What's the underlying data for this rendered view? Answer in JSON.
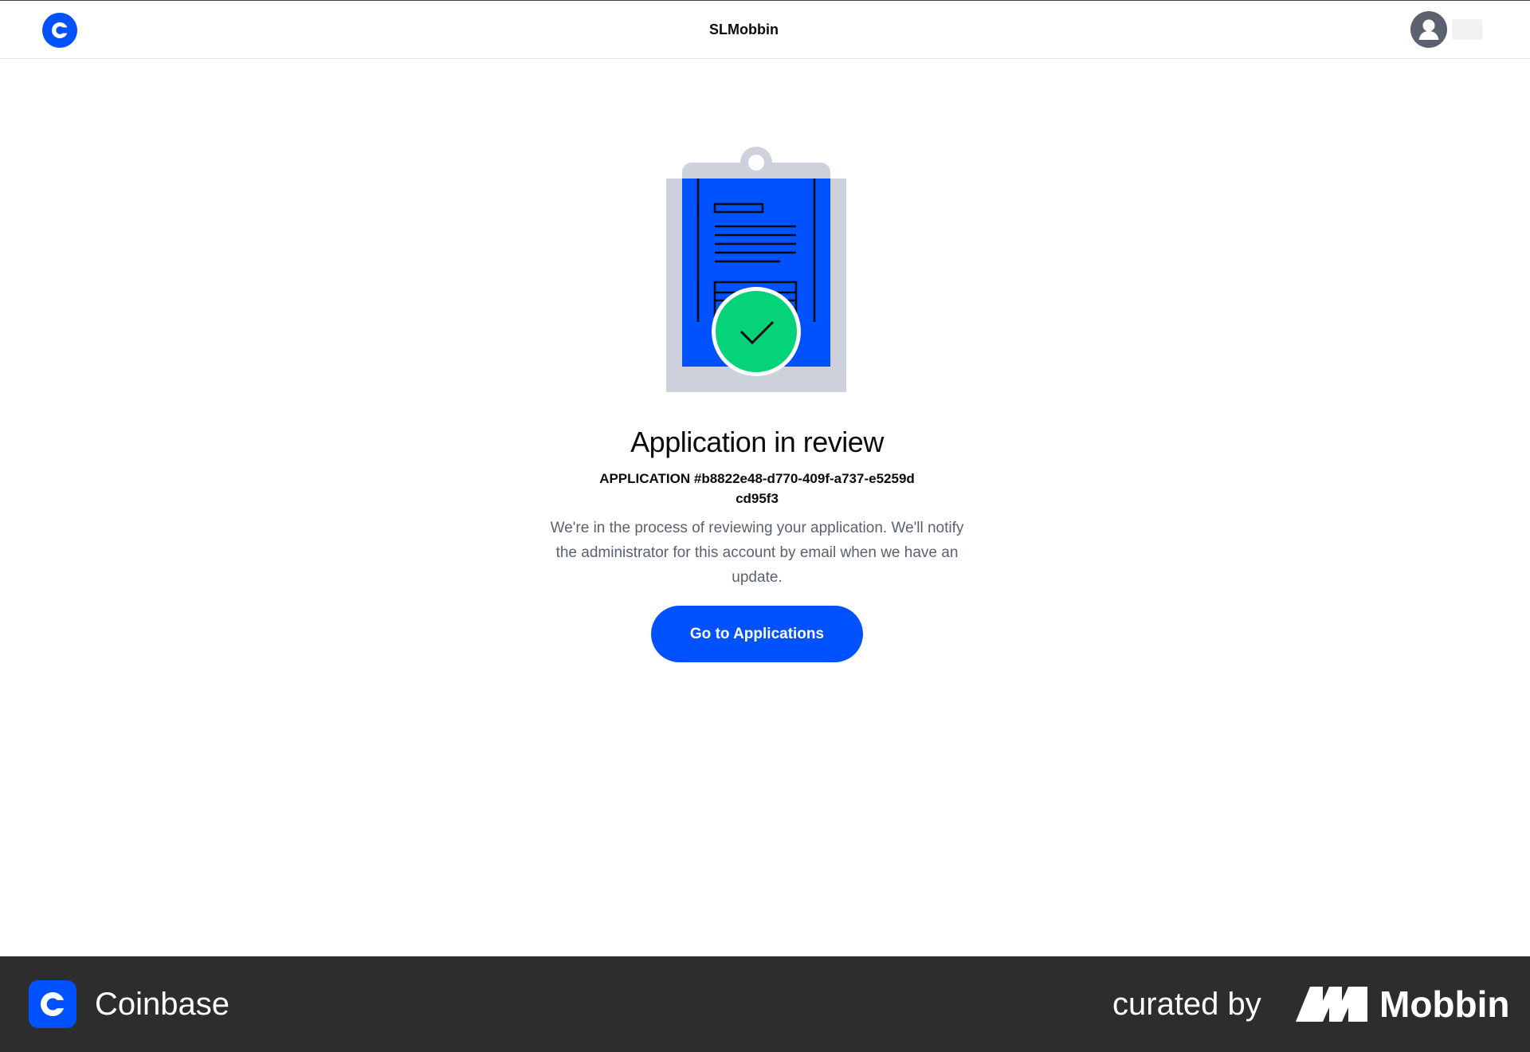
{
  "header": {
    "org_name": "SLMobbin",
    "logo_icon": "coinbase-logo-icon",
    "avatar_icon": "user-avatar-icon"
  },
  "main": {
    "illustration_icon": "clipboard-approved-illustration",
    "title": "Application in review",
    "application_id": "APPLICATION #b8822e48-d770-409f-a737-e5259dcd95f3",
    "description": "We're in the process of reviewing your application. We'll notify the administrator for this account by email when we have an update.",
    "cta_label": "Go to Applications"
  },
  "footer": {
    "app_name": "Coinbase",
    "curated_by": "curated by",
    "brand_name": "Mobbin"
  },
  "colors": {
    "brand_blue": "#0052ff",
    "success_green": "#05d37a",
    "clipboard_gray": "#cdd1db",
    "footer_bg": "#2d2d2d"
  }
}
